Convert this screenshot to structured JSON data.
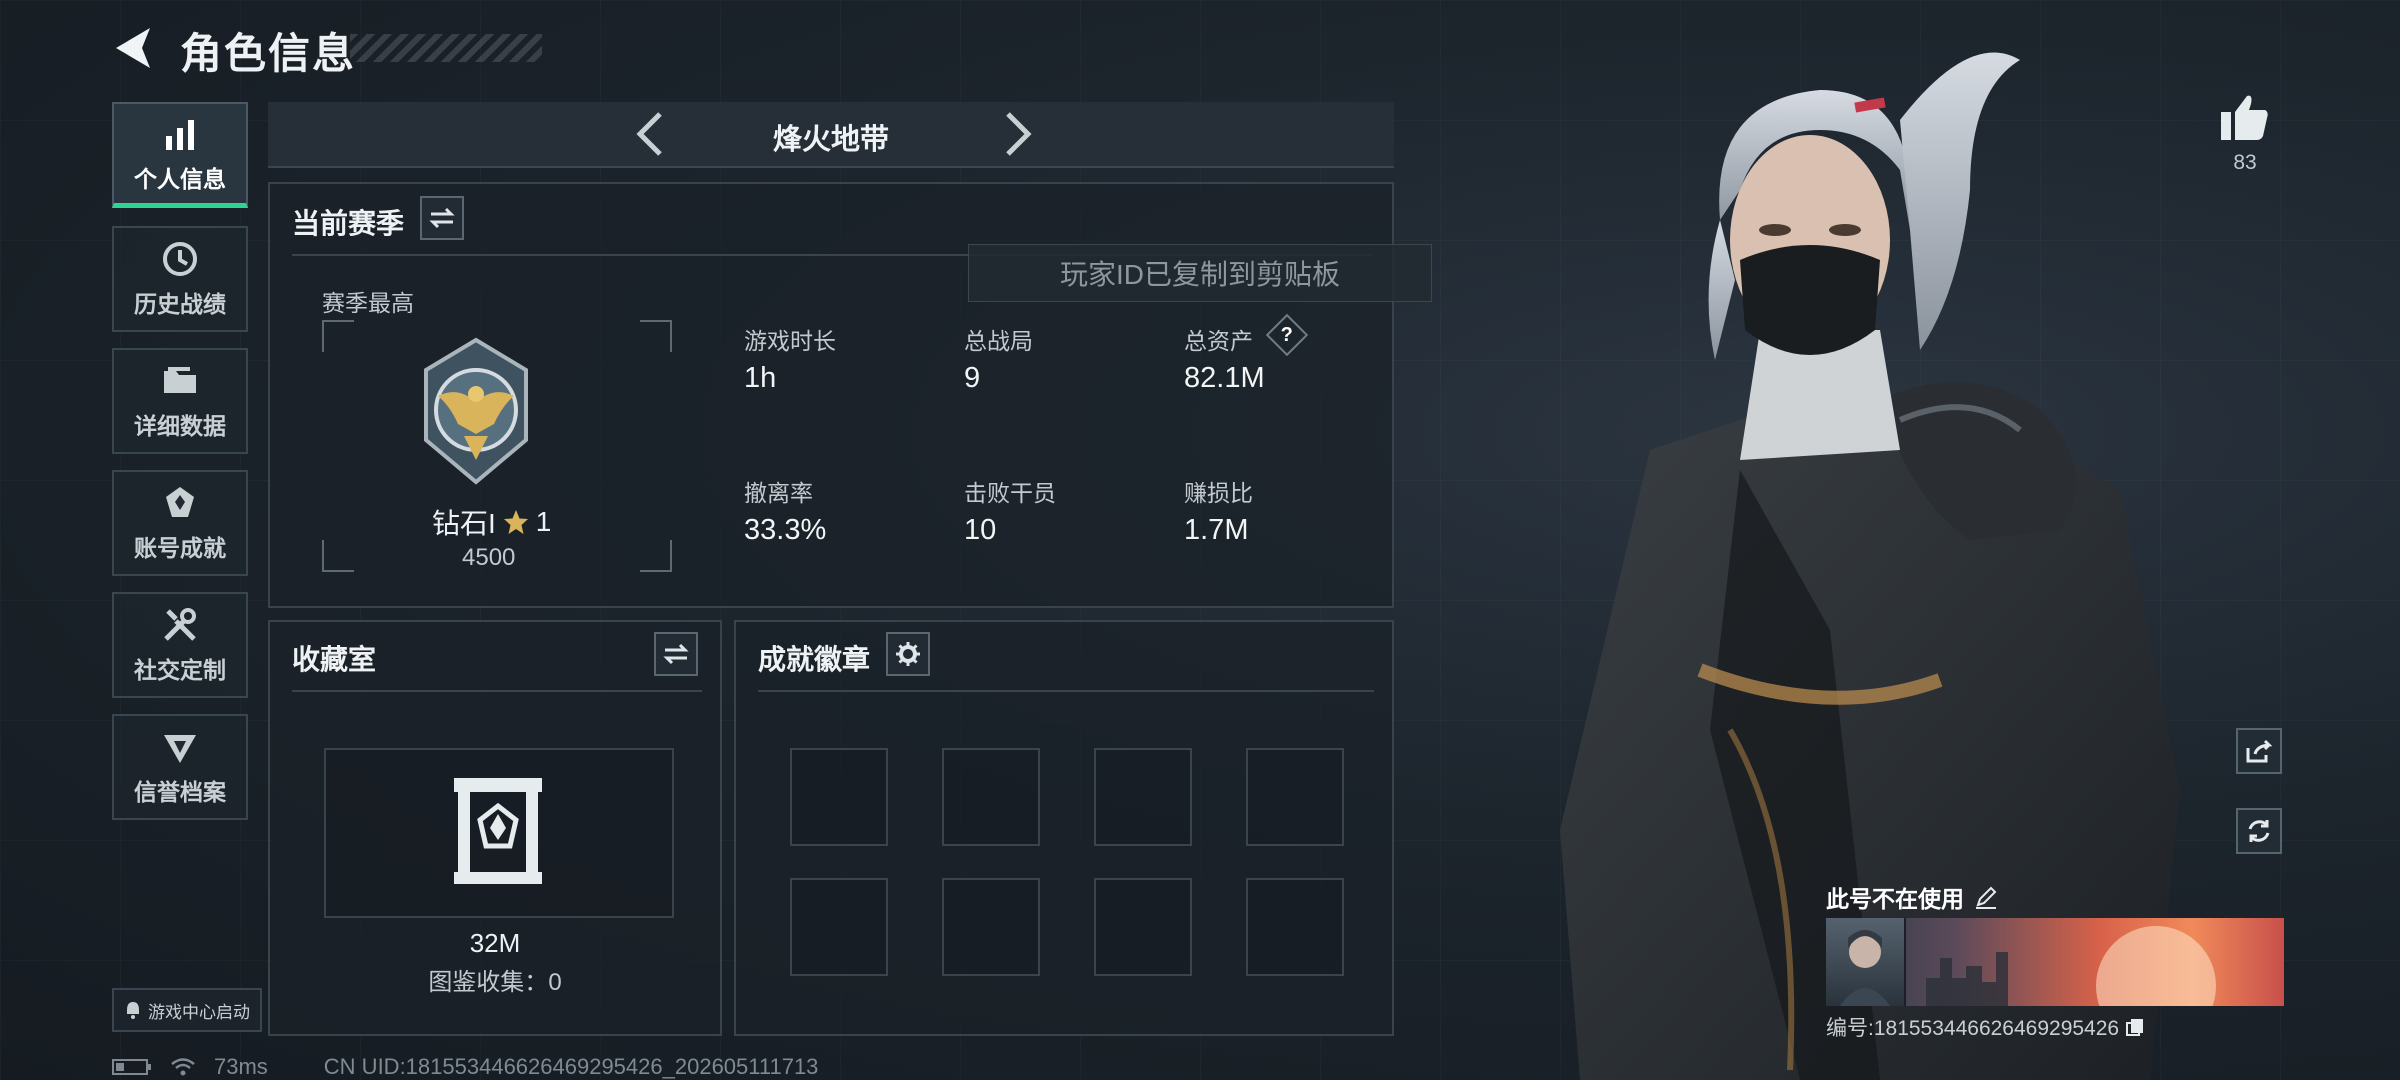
{
  "header": {
    "title": "角色信息"
  },
  "sidebar": {
    "items": [
      {
        "label": "个人信息",
        "icon": "bar-chart-icon",
        "active": true
      },
      {
        "label": "历史战绩",
        "icon": "clock-icon"
      },
      {
        "label": "详细数据",
        "icon": "folder-icon"
      },
      {
        "label": "账号成就",
        "icon": "achievement-icon"
      },
      {
        "label": "社交定制",
        "icon": "tools-icon"
      },
      {
        "label": "信誉档案",
        "icon": "shield-icon"
      }
    ],
    "launch_label": "游戏中心启动"
  },
  "mode": {
    "name": "烽火地带"
  },
  "season": {
    "title": "当前赛季",
    "best_label": "赛季最高",
    "rank_name": "钻石I",
    "rank_stars": "1",
    "rank_score": "4500",
    "stats": [
      {
        "label": "游戏时长",
        "value": "1h"
      },
      {
        "label": "总战局",
        "value": "9"
      },
      {
        "label": "总资产",
        "value": "82.1M",
        "help": "?"
      },
      {
        "label": "撤离率",
        "value": "33.3%"
      },
      {
        "label": "击败干员",
        "value": "10"
      },
      {
        "label": "赚损比",
        "value": "1.7M"
      }
    ]
  },
  "toast": {
    "text": "玩家ID已复制到剪贴板"
  },
  "collection": {
    "title": "收藏室",
    "value": "32M",
    "catalog_label": "图鉴收集：",
    "catalog_value": "0"
  },
  "badges": {
    "title": "成就徽章",
    "slots": 8
  },
  "likes": {
    "count": "83"
  },
  "profile_card": {
    "status": "此号不在使用",
    "id_text": "编号:1815534466264692954​26"
  },
  "status_bar": {
    "ping": "73ms",
    "uid": "CN UID:1815534466264692954​26_202605111713"
  },
  "colors": {
    "accent": "#2fd495",
    "gold": "#d9b45a"
  }
}
